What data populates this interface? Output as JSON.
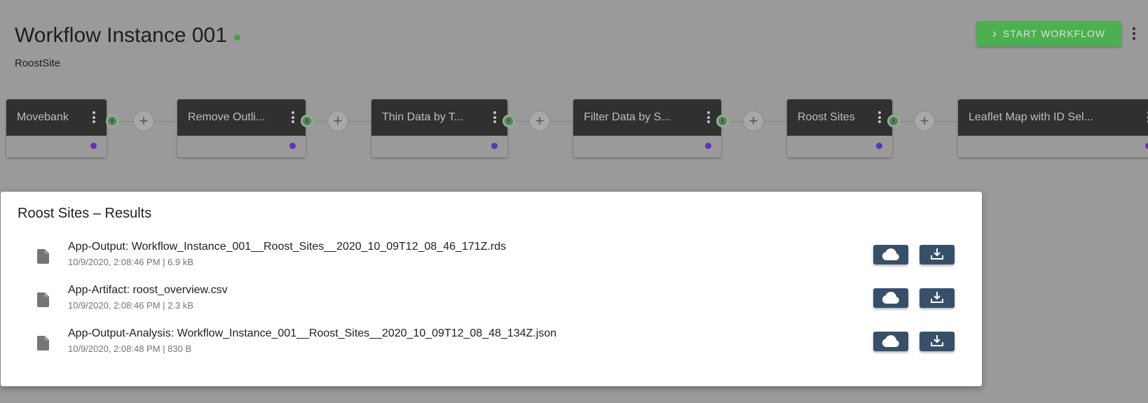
{
  "header": {
    "title": "Workflow Instance 001",
    "status_color": "#43a047",
    "subtitle": "RoostSite",
    "start_button": "START WORKFLOW",
    "start_button_color": "#4caf50"
  },
  "pipeline": {
    "port_color": "#5e35b1",
    "add_label": "+",
    "info_label": "i",
    "apps": [
      {
        "label": "Movebank"
      },
      {
        "label": "Remove Outli..."
      },
      {
        "label": "Thin Data by T..."
      },
      {
        "label": "Filter Data by S..."
      },
      {
        "label": "Roost Sites"
      },
      {
        "label": "Leaflet Map with ID Sel..."
      }
    ]
  },
  "results": {
    "title": "Roost Sites – Results",
    "files": [
      {
        "name": "App-Output: Workflow_Instance_001__Roost_Sites__2020_10_09T12_08_46_171Z.rds",
        "meta": "10/9/2020, 2:08:46 PM | 6.9 kB"
      },
      {
        "name": "App-Artifact: roost_overview.csv",
        "meta": "10/9/2020, 2:08:46 PM | 2.3 kB"
      },
      {
        "name": "App-Output-Analysis: Workflow_Instance_001__Roost_Sites__2020_10_09T12_08_48_134Z.json",
        "meta": "10/9/2020, 2:08:48 PM | 830 B"
      }
    ],
    "action_color": "#37506a"
  },
  "icons": {
    "file": "file-icon",
    "cloud": "cloud-icon",
    "download": "download-icon",
    "more": "more-vert-icon",
    "chevron": "chevron-right-icon",
    "add": "add-icon",
    "info": "info-icon"
  }
}
